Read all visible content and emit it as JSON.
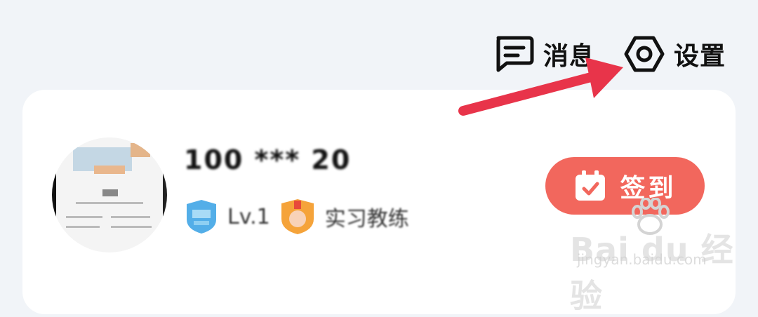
{
  "header": {
    "messages_label": "消息",
    "settings_label": "设置"
  },
  "profile": {
    "username": "100 *** 20",
    "level_text": "Lv.1",
    "badge_text": "实习教练"
  },
  "checkin": {
    "label": "签到"
  },
  "watermark": {
    "brand": "Bai du 经验",
    "url": "jingyan.baidu.com"
  },
  "colors": {
    "accent": "#f2675d",
    "arrow": "#e8344a",
    "background": "#f1f4f8",
    "card": "#ffffff"
  }
}
